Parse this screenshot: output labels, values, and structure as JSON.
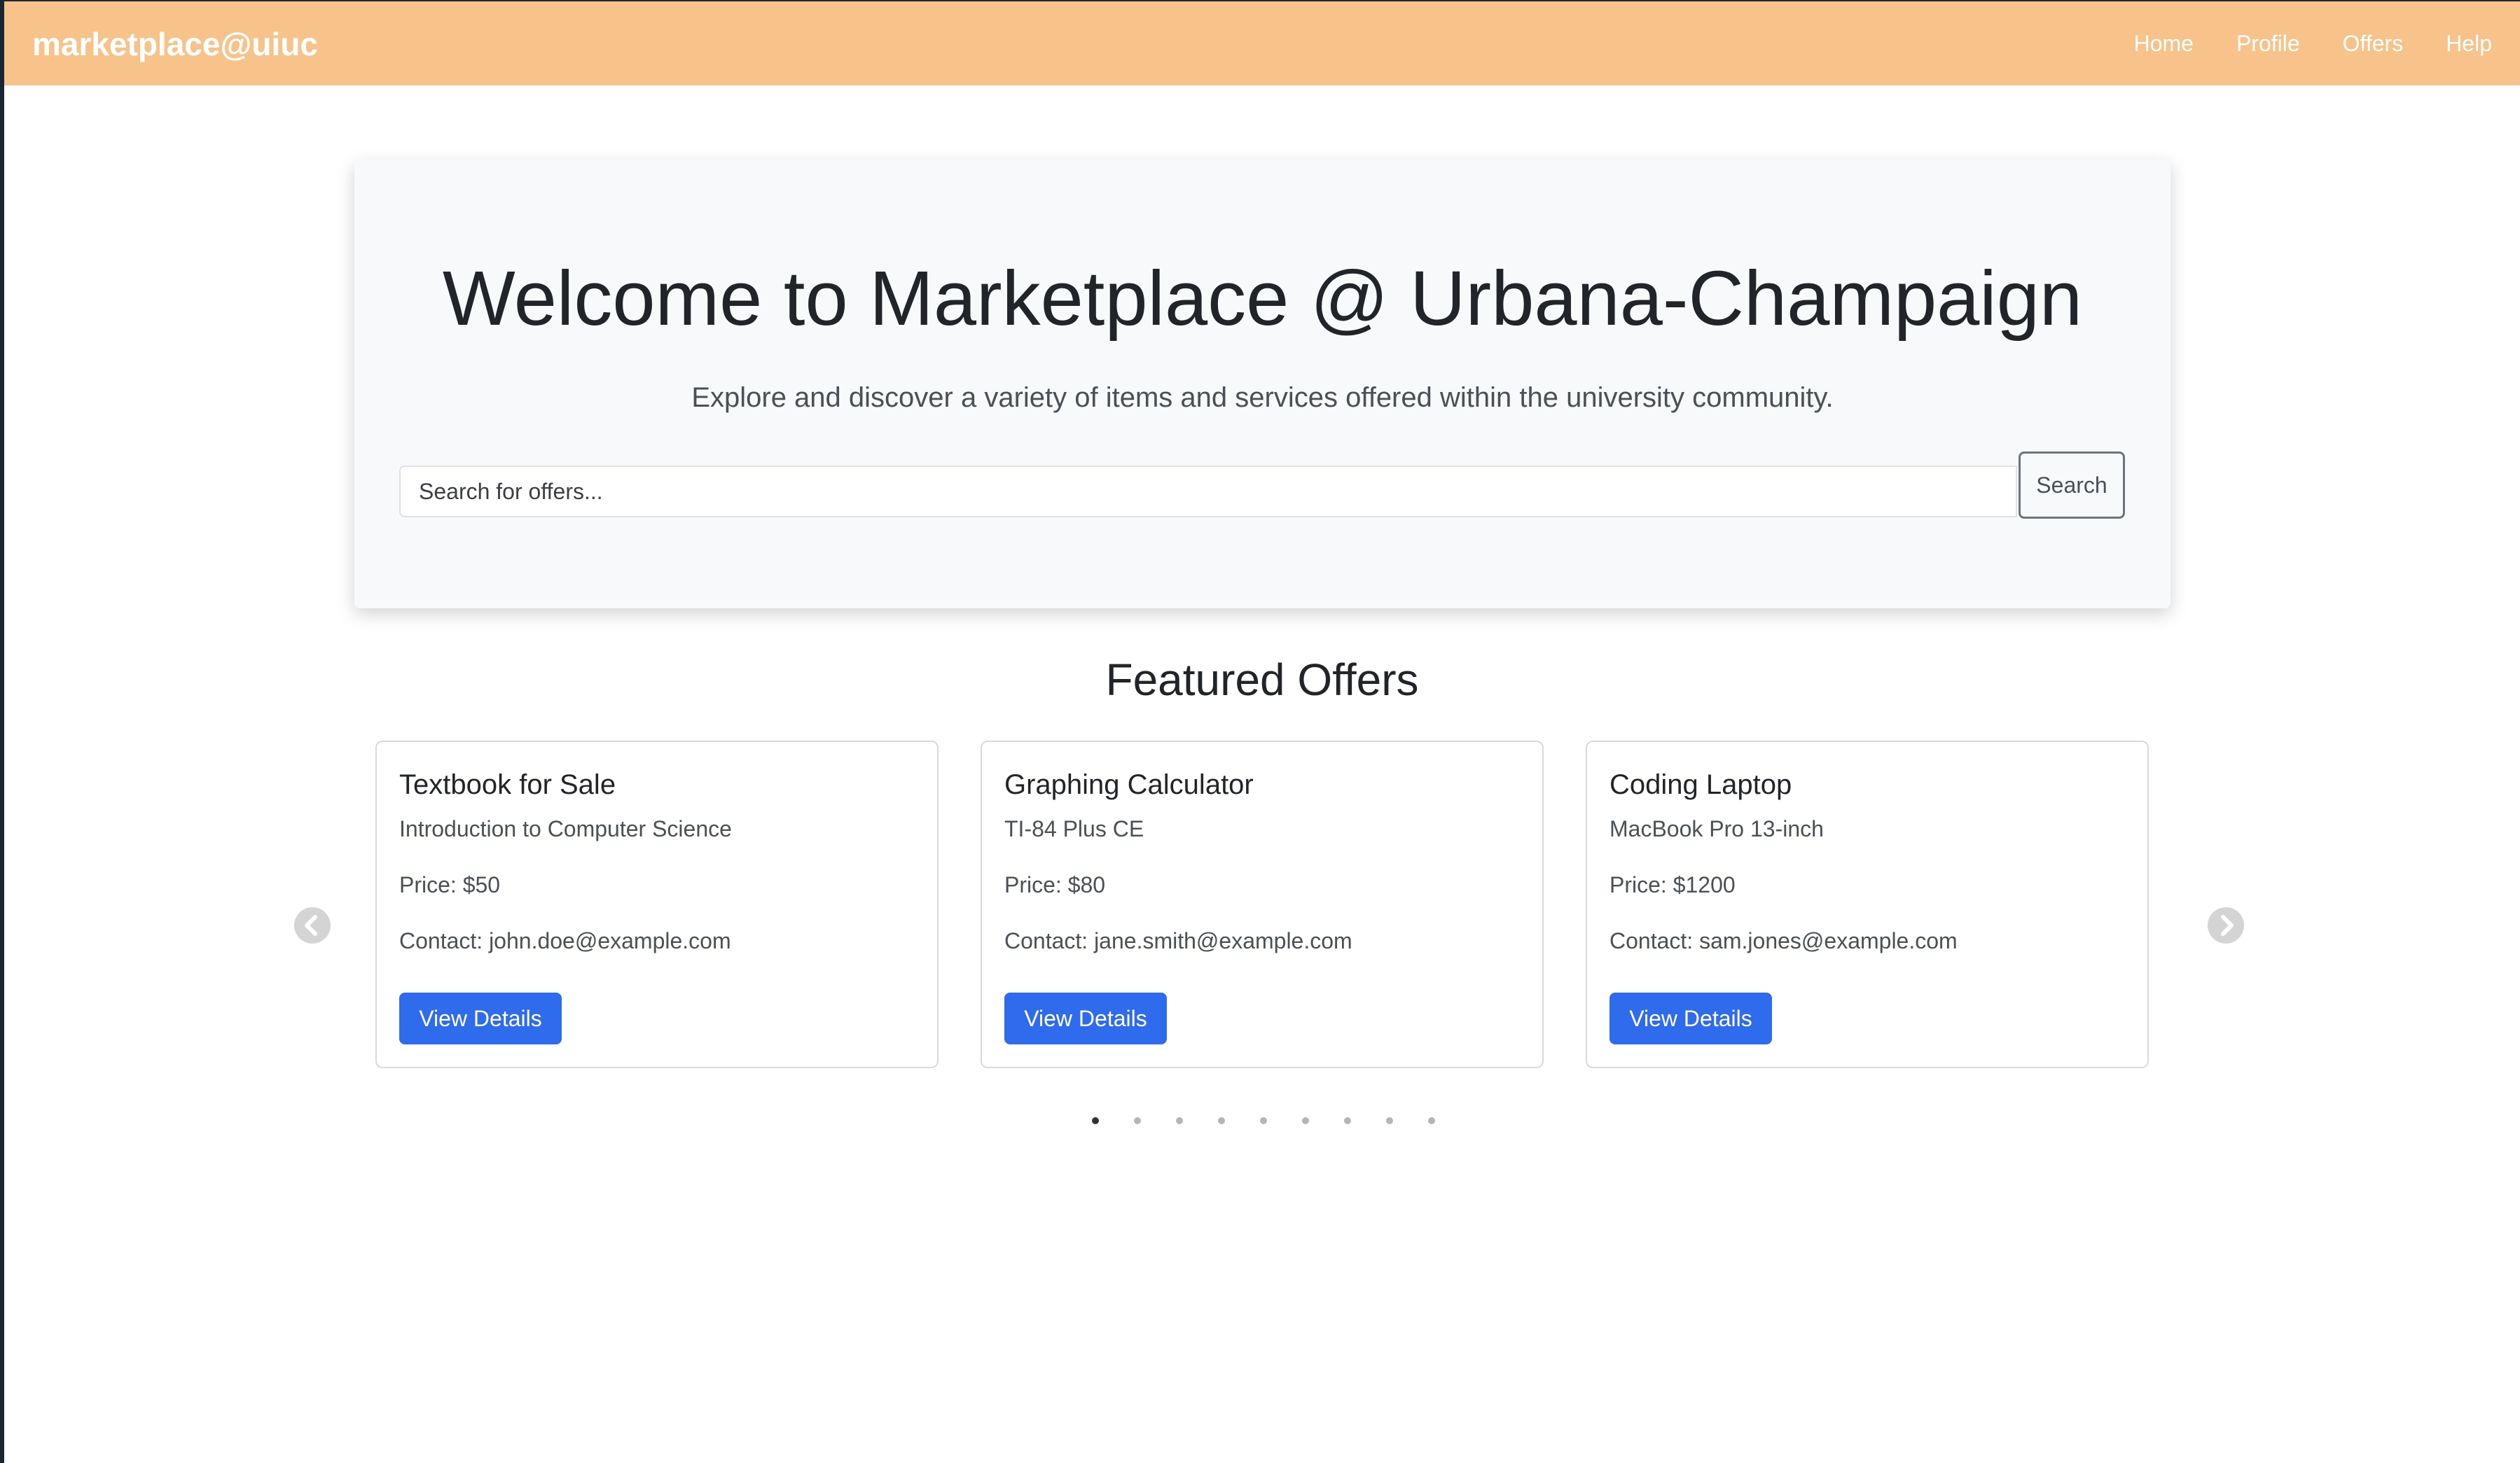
{
  "navbar": {
    "brand": "marketplace@uiuc",
    "links": [
      "Home",
      "Profile",
      "Offers",
      "Help"
    ]
  },
  "hero": {
    "title": "Welcome to Marketplace @ Urbana-Champaign",
    "subtitle": "Explore and discover a variety of items and services offered within the university community.",
    "search_placeholder": "Search for offers...",
    "search_value": "",
    "search_button": "Search"
  },
  "featured": {
    "title": "Featured Offers",
    "cards": [
      {
        "title": "Textbook for Sale",
        "subtitle": "Introduction to Computer Science",
        "price": "Price: $50",
        "contact": "Contact: john.doe@example.com",
        "button": "View Details"
      },
      {
        "title": "Graphing Calculator",
        "subtitle": "TI-84 Plus CE",
        "price": "Price: $80",
        "contact": "Contact: jane.smith@example.com",
        "button": "View Details"
      },
      {
        "title": "Coding Laptop",
        "subtitle": "MacBook Pro 13-inch",
        "price": "Price: $1200",
        "contact": "Contact: sam.jones@example.com",
        "button": "View Details"
      }
    ],
    "carousel": {
      "prev_icon": "chevron-left-icon",
      "next_icon": "chevron-right-icon",
      "total_slides": 9,
      "active_slide": 1
    }
  },
  "colors": {
    "navbar_bg": "#f8c38a",
    "primary_button": "#2f6ced",
    "hero_bg": "#f8f9fa"
  }
}
